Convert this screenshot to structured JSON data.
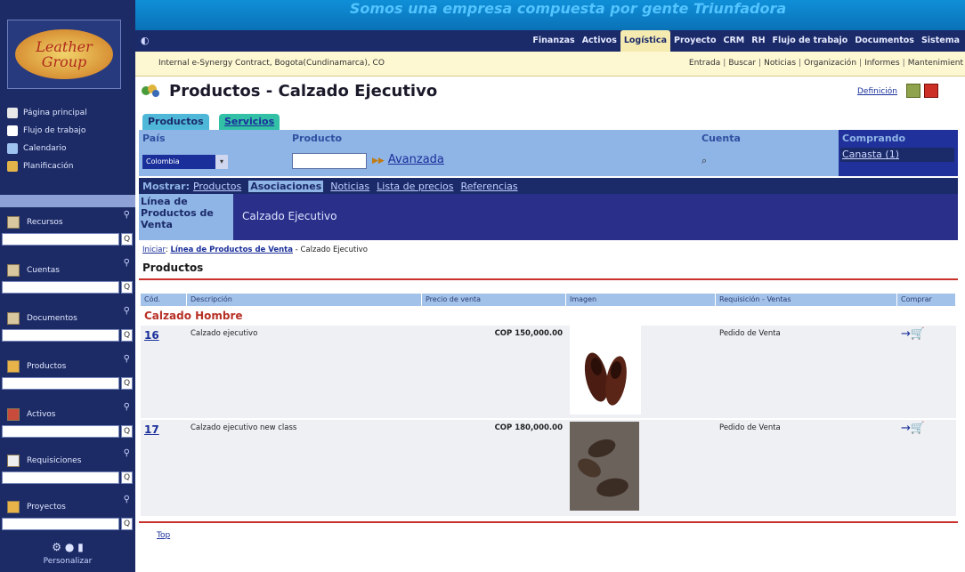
{
  "logo": {
    "line1": "Leather",
    "line2": "Group"
  },
  "sidebar": {
    "nav": [
      {
        "label": "Página principal",
        "icon": "home-icon"
      },
      {
        "label": "Flujo de trabajo",
        "icon": "workflow-icon"
      },
      {
        "label": "Calendario",
        "icon": "calendar-icon"
      },
      {
        "label": "Planificación",
        "icon": "planning-icon"
      }
    ],
    "sections": [
      {
        "label": "Recursos"
      },
      {
        "label": "Cuentas"
      },
      {
        "label": "Documentos"
      },
      {
        "label": "Productos"
      },
      {
        "label": "Activos"
      },
      {
        "label": "Requisiciones"
      },
      {
        "label": "Proyectos"
      }
    ],
    "search_go": "Q",
    "personalize": "Personalizar"
  },
  "banner": {
    "text": "Somos una empresa compuesta por gente Triunfadora"
  },
  "menu": {
    "items": [
      "Finanzas",
      "Activos",
      "Logística",
      "Proyecto",
      "CRM",
      "RH",
      "Flujo de trabajo",
      "Documentos",
      "Sistema"
    ],
    "active": "Logística"
  },
  "info": {
    "left": "Internal e-Synergy Contract, Bogota(Cundinamarca), CO",
    "right": [
      "Entrada",
      "Buscar",
      "Noticias",
      "Organización",
      "Informes",
      "Mantenimient"
    ]
  },
  "header": {
    "title": "Productos - Calzado Ejecutivo",
    "def_label": "Definición"
  },
  "tabs": [
    "Productos",
    "Servicios"
  ],
  "search": {
    "country_label": "País",
    "country_value": "Colombia",
    "product_label": "Producto",
    "product_value": "",
    "advanced": "Avanzada",
    "account_label": "Cuenta",
    "buying_label": "Comprando",
    "cart": "Canasta (1)"
  },
  "show": {
    "label": "Mostrar:",
    "links": [
      {
        "label": "Productos",
        "selected": false
      },
      {
        "label": "Asociaciones",
        "selected": true
      },
      {
        "label": "Noticias",
        "selected": false
      },
      {
        "label": "Lista de precios",
        "selected": false
      },
      {
        "label": "Referencias",
        "selected": false
      }
    ]
  },
  "line": {
    "label": "Línea de Productos de Venta",
    "value": "Calzado Ejecutivo"
  },
  "breadcrumb": {
    "start": "Iniciar",
    "sep1": ":",
    "line": "Línea de Productos de Venta",
    "sep2": " - ",
    "current": "Calzado Ejecutivo"
  },
  "section_title": "Productos",
  "table": {
    "headers": [
      "Cód.",
      "Descripción",
      "Precio de venta",
      "Imagen",
      "Requisición - Ventas",
      "Comprar"
    ],
    "group": "Calzado Hombre",
    "rows": [
      {
        "code": "16",
        "description": "Calzado ejecutivo",
        "price": "COP 150,000.00",
        "requisition": "Pedido de Venta"
      },
      {
        "code": "17",
        "description": "Calzado ejecutivo new class",
        "price": "COP 180,000.00",
        "requisition": "Pedido de Venta"
      }
    ]
  },
  "top_link": "Top",
  "colors": {
    "nav_dark": "#1b2a69",
    "panel_blue": "#8fb4e6",
    "accent_red": "#c9302c",
    "active_tab": "#f5eab0"
  }
}
